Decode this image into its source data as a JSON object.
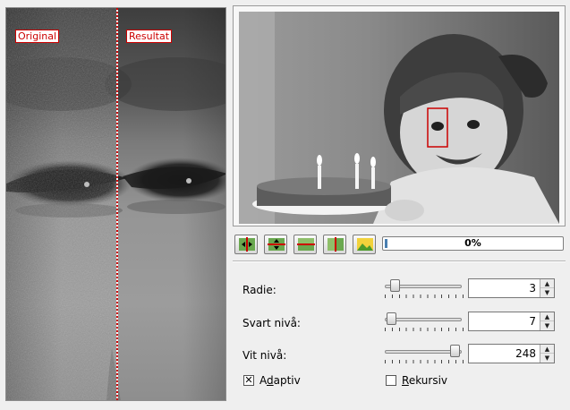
{
  "preview": {
    "original_label": "Original",
    "result_label": "Resultat"
  },
  "toolbar": {
    "buttons": [
      {
        "name": "split-vertical-move-icon"
      },
      {
        "name": "split-horizontal-move-icon"
      },
      {
        "name": "split-horizontal-icon"
      },
      {
        "name": "split-vertical-icon"
      },
      {
        "name": "no-split-icon"
      }
    ],
    "progress_text": "0%",
    "progress_value": 0
  },
  "params": {
    "radius": {
      "label": "Radie:",
      "value": "3",
      "min": 0,
      "max": 20
    },
    "black": {
      "label": "Svart nivå:",
      "value": "7",
      "min": 0,
      "max": 255
    },
    "white": {
      "label": "Vit nivå:",
      "value": "248",
      "min": 0,
      "max": 255
    }
  },
  "options": {
    "adaptive": {
      "label_pre": "A",
      "label_underline": "d",
      "label_post": "aptiv",
      "checked": true
    },
    "recursive": {
      "label_pre": "",
      "label_underline": "R",
      "label_post": "ekursiv",
      "checked": false
    }
  },
  "colors": {
    "split_line": "#cc0000",
    "accent": "#4a7fb0"
  }
}
